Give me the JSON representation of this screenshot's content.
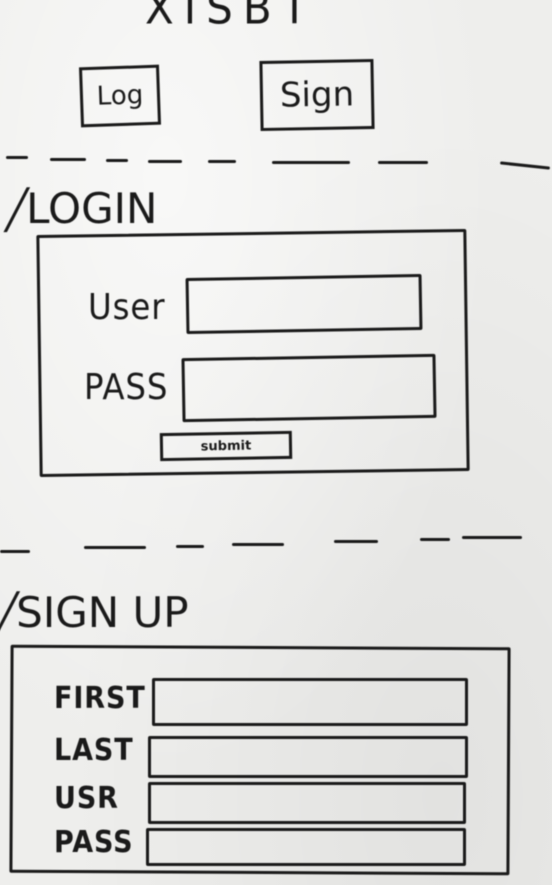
{
  "header": {
    "title": "XISBT"
  },
  "nav": {
    "log_label": "Log",
    "sign_label": "Sign"
  },
  "login": {
    "heading": "LOGIN",
    "user_label": "User",
    "pass_label": "PASS",
    "submit_label": "submit"
  },
  "signup": {
    "heading": "SIGN UP",
    "first_label": "FIRST",
    "last_label": "LAST",
    "usr_label": "USR",
    "pass_label": "PASS"
  }
}
